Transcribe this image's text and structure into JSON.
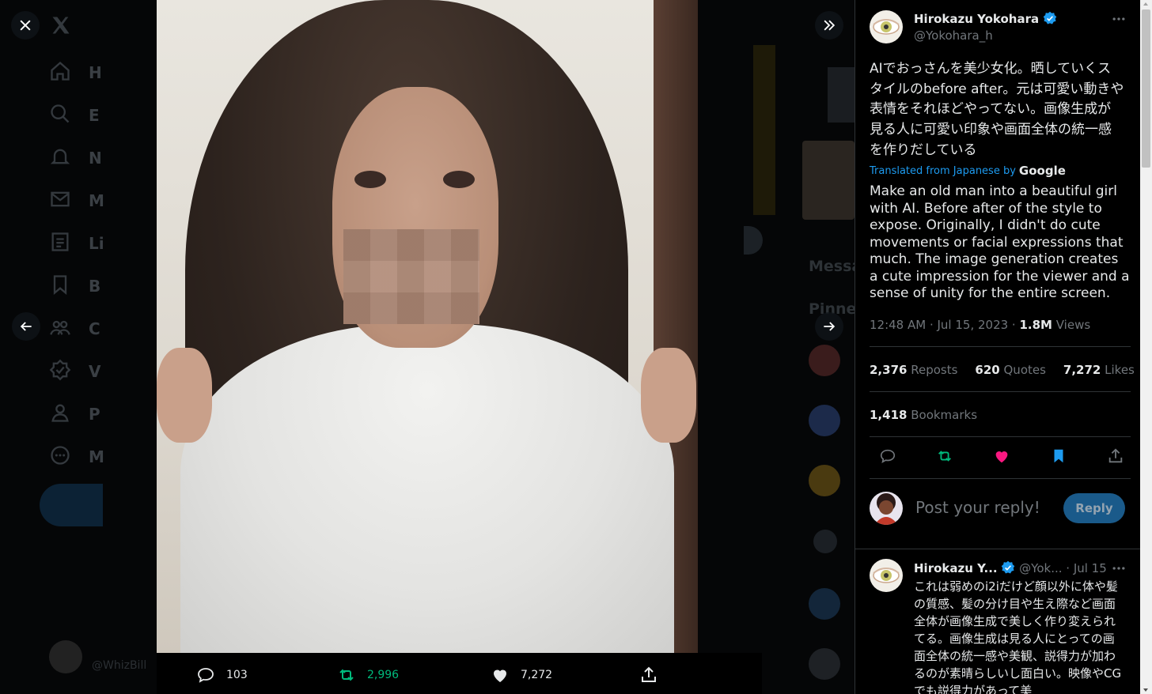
{
  "colors": {
    "accent": "#1d9bf0",
    "retweet": "#00ba7c",
    "like": "#f91880",
    "bookmark": "#1d9bf0"
  },
  "background": {
    "nav_letters": [
      "H",
      "E",
      "N",
      "M",
      "Li",
      "B",
      "C",
      "V",
      "P",
      "M"
    ],
    "right_texts": [
      "Messa",
      "Pinne"
    ],
    "bottom_handle": "@WhizBill"
  },
  "media": {
    "reply_count": "103",
    "retweet_count": "2,996",
    "like_count": "7,272"
  },
  "tweet": {
    "author_name": "Hirokazu Yokohara",
    "author_handle": "@Yokohara_h",
    "text_jp": "AIでおっさんを美少女化。晒していくスタイルのbefore after。元は可愛い動きや表情をそれほどやってない。画像生成が見る人に可愛い印象や画面全体の統一感を作りだしている",
    "translated_label": "Translated from Japanese by",
    "translated_provider": "Google",
    "text_en": "Make an old man into a beautiful girl with AI. Before after of the style to expose. Originally, I didn't do cute movements or facial expressions that much. The image generation creates a cute impression for the viewer and a sense of unity for the entire screen.",
    "time": "12:48 AM · Jul 15, 2023 · ",
    "views_count": "1.8M",
    "views_label": " Views",
    "reposts_count": "2,376",
    "reposts_label": " Reposts",
    "quotes_count": "620",
    "quotes_label": " Quotes",
    "likes_count": "7,272",
    "likes_label": " Likes",
    "bookmarks_count": "1,418",
    "bookmarks_label": " Bookmarks"
  },
  "reply_box": {
    "placeholder": "Post your reply!",
    "button_label": "Reply"
  },
  "reply": {
    "author_name": "Hirokazu Y...",
    "author_handle": "@Yok...",
    "date": " · Jul 15",
    "text": "これは弱めのi2iだけど顔以外に体や髪の質感、髪の分け目や生え際など画面全体が画像生成で美しく作り変えられてる。画像生成は見る人にとっての画面全体の統一感や美観、説得力が加わるのが素晴らしいし面白い。映像やCGでも説得力があって美"
  }
}
